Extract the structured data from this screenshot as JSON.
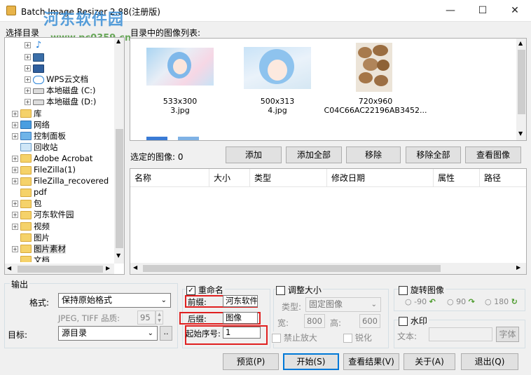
{
  "window": {
    "title": "Batch Image Resizer 2.88(注册版)",
    "minimize": "—",
    "maximize": "☐",
    "close": "✕"
  },
  "watermark": {
    "line1": "河东软件园",
    "line2": "www.pc0359.cn"
  },
  "folder_tree": {
    "label": "选择目录",
    "items": [
      {
        "label": "",
        "icon": "music-folder-icon",
        "depth": 2
      },
      {
        "label": "",
        "icon": "video-folder-icon",
        "depth": 2
      },
      {
        "label": "",
        "icon": "desktop-folder-icon",
        "depth": 2
      },
      {
        "label": "WPS云文档",
        "icon": "cloud-icon",
        "depth": 2
      },
      {
        "label": "本地磁盘 (C:)",
        "icon": "drive-icon",
        "depth": 2
      },
      {
        "label": "本地磁盘 (D:)",
        "icon": "drive-icon",
        "depth": 2
      },
      {
        "label": "库",
        "icon": "folder-icon",
        "depth": 0
      },
      {
        "label": "网络",
        "icon": "network-icon",
        "depth": 0
      },
      {
        "label": "控制面板",
        "icon": "control-panel-icon",
        "depth": 0
      },
      {
        "label": "回收站",
        "icon": "recycle-bin-icon",
        "depth": 0
      },
      {
        "label": "Adobe Acrobat",
        "icon": "folder-icon",
        "depth": 0
      },
      {
        "label": "FileZilla(1)",
        "icon": "folder-icon",
        "depth": 0
      },
      {
        "label": "FileZilla_recovered",
        "icon": "folder-icon",
        "depth": 0
      },
      {
        "label": "pdf",
        "icon": "folder-icon",
        "depth": 0
      },
      {
        "label": "包",
        "icon": "folder-icon",
        "depth": 0
      },
      {
        "label": "河东软件园",
        "icon": "folder-icon",
        "depth": 0
      },
      {
        "label": "视频",
        "icon": "folder-icon",
        "depth": 0
      },
      {
        "label": "图片",
        "icon": "folder-icon",
        "depth": 0
      },
      {
        "label": "图片素材",
        "icon": "folder-icon",
        "depth": 0
      },
      {
        "label": "文档",
        "icon": "folder-icon",
        "depth": 0
      }
    ]
  },
  "image_list": {
    "label": "目录中的图像列表:",
    "images": [
      {
        "size": "533x300",
        "name": "3.jpg"
      },
      {
        "size": "500x313",
        "name": "4.jpg"
      },
      {
        "size": "720x960",
        "name": "C04C66AC22196AB3452..."
      }
    ]
  },
  "selected": {
    "label": "选定的图像: 0",
    "buttons": {
      "add": "添加",
      "add_all": "添加全部",
      "remove": "移除",
      "remove_all": "移除全部",
      "view": "查看图像"
    },
    "columns": [
      "名称",
      "大小",
      "类型",
      "修改日期",
      "属性",
      "路径"
    ]
  },
  "output": {
    "group_label": "输出",
    "format_label": "格式:",
    "format_value": "保持原始格式",
    "quality_label": "JPEG, TIFF 品质:",
    "quality_value": "95",
    "target_label": "目标:",
    "target_value": "源目录",
    "browse": ".."
  },
  "rename": {
    "label": "重命名",
    "checked": true,
    "prefix_label": "前缀:",
    "prefix_value": "河东软件",
    "suffix_label": "后缀:",
    "suffix_value": "图像",
    "start_label": "起始序号:",
    "start_value": "1"
  },
  "resize": {
    "label": "调整大小",
    "type_label": "类型:",
    "type_value": "固定图像",
    "width_label": "宽:",
    "width_value": "800",
    "height_label": "高:",
    "height_value": "600",
    "no_enlarge": "禁止放大",
    "sharpen": "锐化"
  },
  "rotate": {
    "label": "旋转图像",
    "options": [
      "-90",
      "90",
      "180"
    ]
  },
  "watermark_opts": {
    "label": "水印",
    "text_label": "文本:",
    "font_button": "字体"
  },
  "actions": {
    "preview": "预览(P)",
    "start": "开始(S)",
    "view_results": "查看结果(V)",
    "about": "关于(A)",
    "exit": "退出(Q)"
  }
}
